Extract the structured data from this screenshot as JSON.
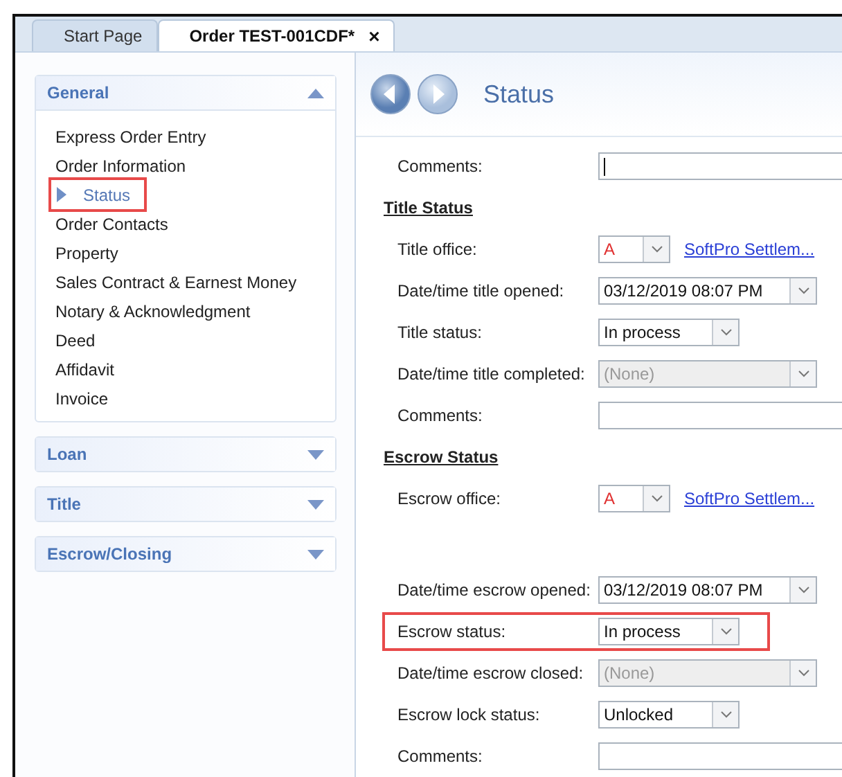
{
  "tabs": [
    {
      "label": "Start Page",
      "selected": false
    },
    {
      "label": "Order TEST-001CDF*",
      "selected": true,
      "close": "×"
    }
  ],
  "sidebar": {
    "groups": [
      {
        "title": "General",
        "expanded": true,
        "items": [
          {
            "label": "Express Order Entry",
            "selected": false,
            "highlighted": false
          },
          {
            "label": "Order Information",
            "selected": false,
            "highlighted": false
          },
          {
            "label": "Status",
            "selected": true,
            "highlighted": true
          },
          {
            "label": "Order Contacts",
            "selected": false,
            "highlighted": false
          },
          {
            "label": "Property",
            "selected": false,
            "highlighted": false
          },
          {
            "label": "Sales Contract & Earnest Money",
            "selected": false,
            "highlighted": false
          },
          {
            "label": "Notary & Acknowledgment",
            "selected": false,
            "highlighted": false
          },
          {
            "label": "Deed",
            "selected": false,
            "highlighted": false
          },
          {
            "label": "Affidavit",
            "selected": false,
            "highlighted": false
          },
          {
            "label": "Invoice",
            "selected": false,
            "highlighted": false
          }
        ]
      },
      {
        "title": "Loan",
        "expanded": false
      },
      {
        "title": "Title",
        "expanded": false
      },
      {
        "title": "Escrow/Closing",
        "expanded": false
      }
    ]
  },
  "content": {
    "title": "Status",
    "rows": [
      {
        "kind": "text",
        "label": "Comments:",
        "focused": true
      },
      {
        "kind": "heading",
        "label": "Title Status"
      },
      {
        "kind": "office",
        "label": "Title office:",
        "code": "A",
        "link": "SoftPro Settlem..."
      },
      {
        "kind": "datetime",
        "label": "Date/time title opened:",
        "value": "03/12/2019 08:07 PM",
        "disabled": false
      },
      {
        "kind": "select",
        "label": "Title status:",
        "value": "In process",
        "highlighted": false
      },
      {
        "kind": "datetime",
        "label": "Date/time title completed:",
        "value": "(None)",
        "disabled": true
      },
      {
        "kind": "text",
        "label": "Comments:",
        "focused": false
      },
      {
        "kind": "heading",
        "label": "Escrow Status"
      },
      {
        "kind": "office",
        "label": "Escrow office:",
        "code": "A",
        "link": "SoftPro Settlem..."
      },
      {
        "kind": "gap"
      },
      {
        "kind": "datetime",
        "label": "Date/time escrow opened:",
        "value": "03/12/2019 08:07 PM",
        "disabled": false
      },
      {
        "kind": "select",
        "label": "Escrow status:",
        "value": "In process",
        "highlighted": true
      },
      {
        "kind": "datetime",
        "label": "Date/time escrow closed:",
        "value": "(None)",
        "disabled": true
      },
      {
        "kind": "select",
        "label": "Escrow lock status:",
        "value": "Unlocked",
        "highlighted": false
      },
      {
        "kind": "text",
        "label": "Comments:",
        "focused": false
      }
    ]
  }
}
